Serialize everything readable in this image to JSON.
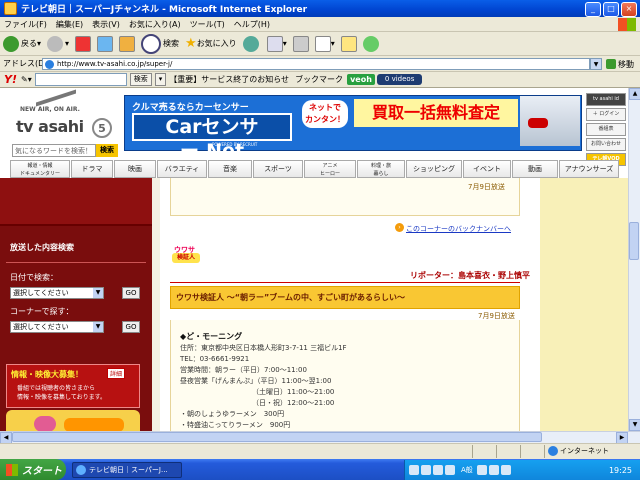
{
  "window": {
    "title": "テレビ朝日｜スーパーJチャンネル - Microsoft Internet Explorer"
  },
  "menu": [
    "ファイル(F)",
    "編集(E)",
    "表示(V)",
    "お気に入り(A)",
    "ツール(T)",
    "ヘルプ(H)"
  ],
  "toolbar": {
    "back": "戻る",
    "search": "検索",
    "favorites": "お気に入り"
  },
  "address": {
    "label": "アドレス(D)",
    "url": "http://www.tv-asahi.co.jp/super-j/",
    "go": "移動"
  },
  "yahoo": {
    "logo": "Y!",
    "search_btn": "検索",
    "notice": "【重要】サービス終了のお知らせ",
    "bookmark": "ブックマーク",
    "veoh": "veoh",
    "videos": "0 videos"
  },
  "header": {
    "logo_top": "NEW AIR, ON AIR.",
    "logo_text": "tv asahi",
    "logo_5": "5",
    "search_placeholder": "気になるワードを検索！",
    "search_btn": "検索"
  },
  "banner": {
    "sub": "クルマ売るならカーセンサー",
    "main": "Carセンサー.Net",
    "powered": "POWERED BY RECRUIT",
    "bubble": "ネットで\nカンタン！",
    "cta": "買取一括無料査定"
  },
  "side_links": [
    "tv asahi id",
    "＋ ログイン",
    "番組表",
    "お問い合わせ",
    "テレ朝VOD"
  ],
  "nav": [
    "報道・情報\nドキュメンタリー",
    "ドラマ",
    "映画",
    "バラエティ",
    "音楽",
    "スポーツ",
    "アニメ\nヒーロー",
    "料理・旅\n暮らし",
    "ショッピング",
    "イベント",
    "動画",
    "アナウンサーズ"
  ],
  "left": {
    "title": "放送した内容検索",
    "date_label": "日付で検索：",
    "date_select": "選択してください",
    "corner_label": "コーナーで探す：",
    "corner_select": "選択してください",
    "go": "GO",
    "info_title": "情報・映像大募集！",
    "info_more": "詳細",
    "info_line1": "番組では視聴者の皆さまから",
    "info_line2": "情報・映像を募集しております。"
  },
  "content": {
    "prev_date": "7月9日放送",
    "back_numbers": "このコーナーのバックナンバーへ",
    "corner_logo_top": "ウワサ",
    "corner_logo_bottom": "検証人",
    "reporter": "リポーター：島本喜衣・野上慎平",
    "article_title": "ウワサ検証人 ～“朝ラー”ブームの中、すごい町があるらしい～",
    "article_date": "7月9日放送",
    "body": [
      "◆ど・モーニング",
      "住所：東京都中央区日本橋人形町3-7-11 三福ビル1F",
      "TEL：03-6661-9921",
      "営業時間：朝ラー（平日）7:00～11:00",
      "昼夜営業「げんまんぷ」（平日）11:00～翌1:00",
      "（土曜日）11:00～21:00",
      "（日・祝）12:00～21:00",
      "・朝のしょうゆラーメン　300円",
      "・特盛油こってりラーメン　900円"
    ]
  },
  "status": {
    "zone": "インターネット"
  },
  "taskbar": {
    "start": "スタート",
    "task": "テレビ朝日｜スーパーJ...",
    "tray": "A般",
    "clock": "19:25"
  }
}
